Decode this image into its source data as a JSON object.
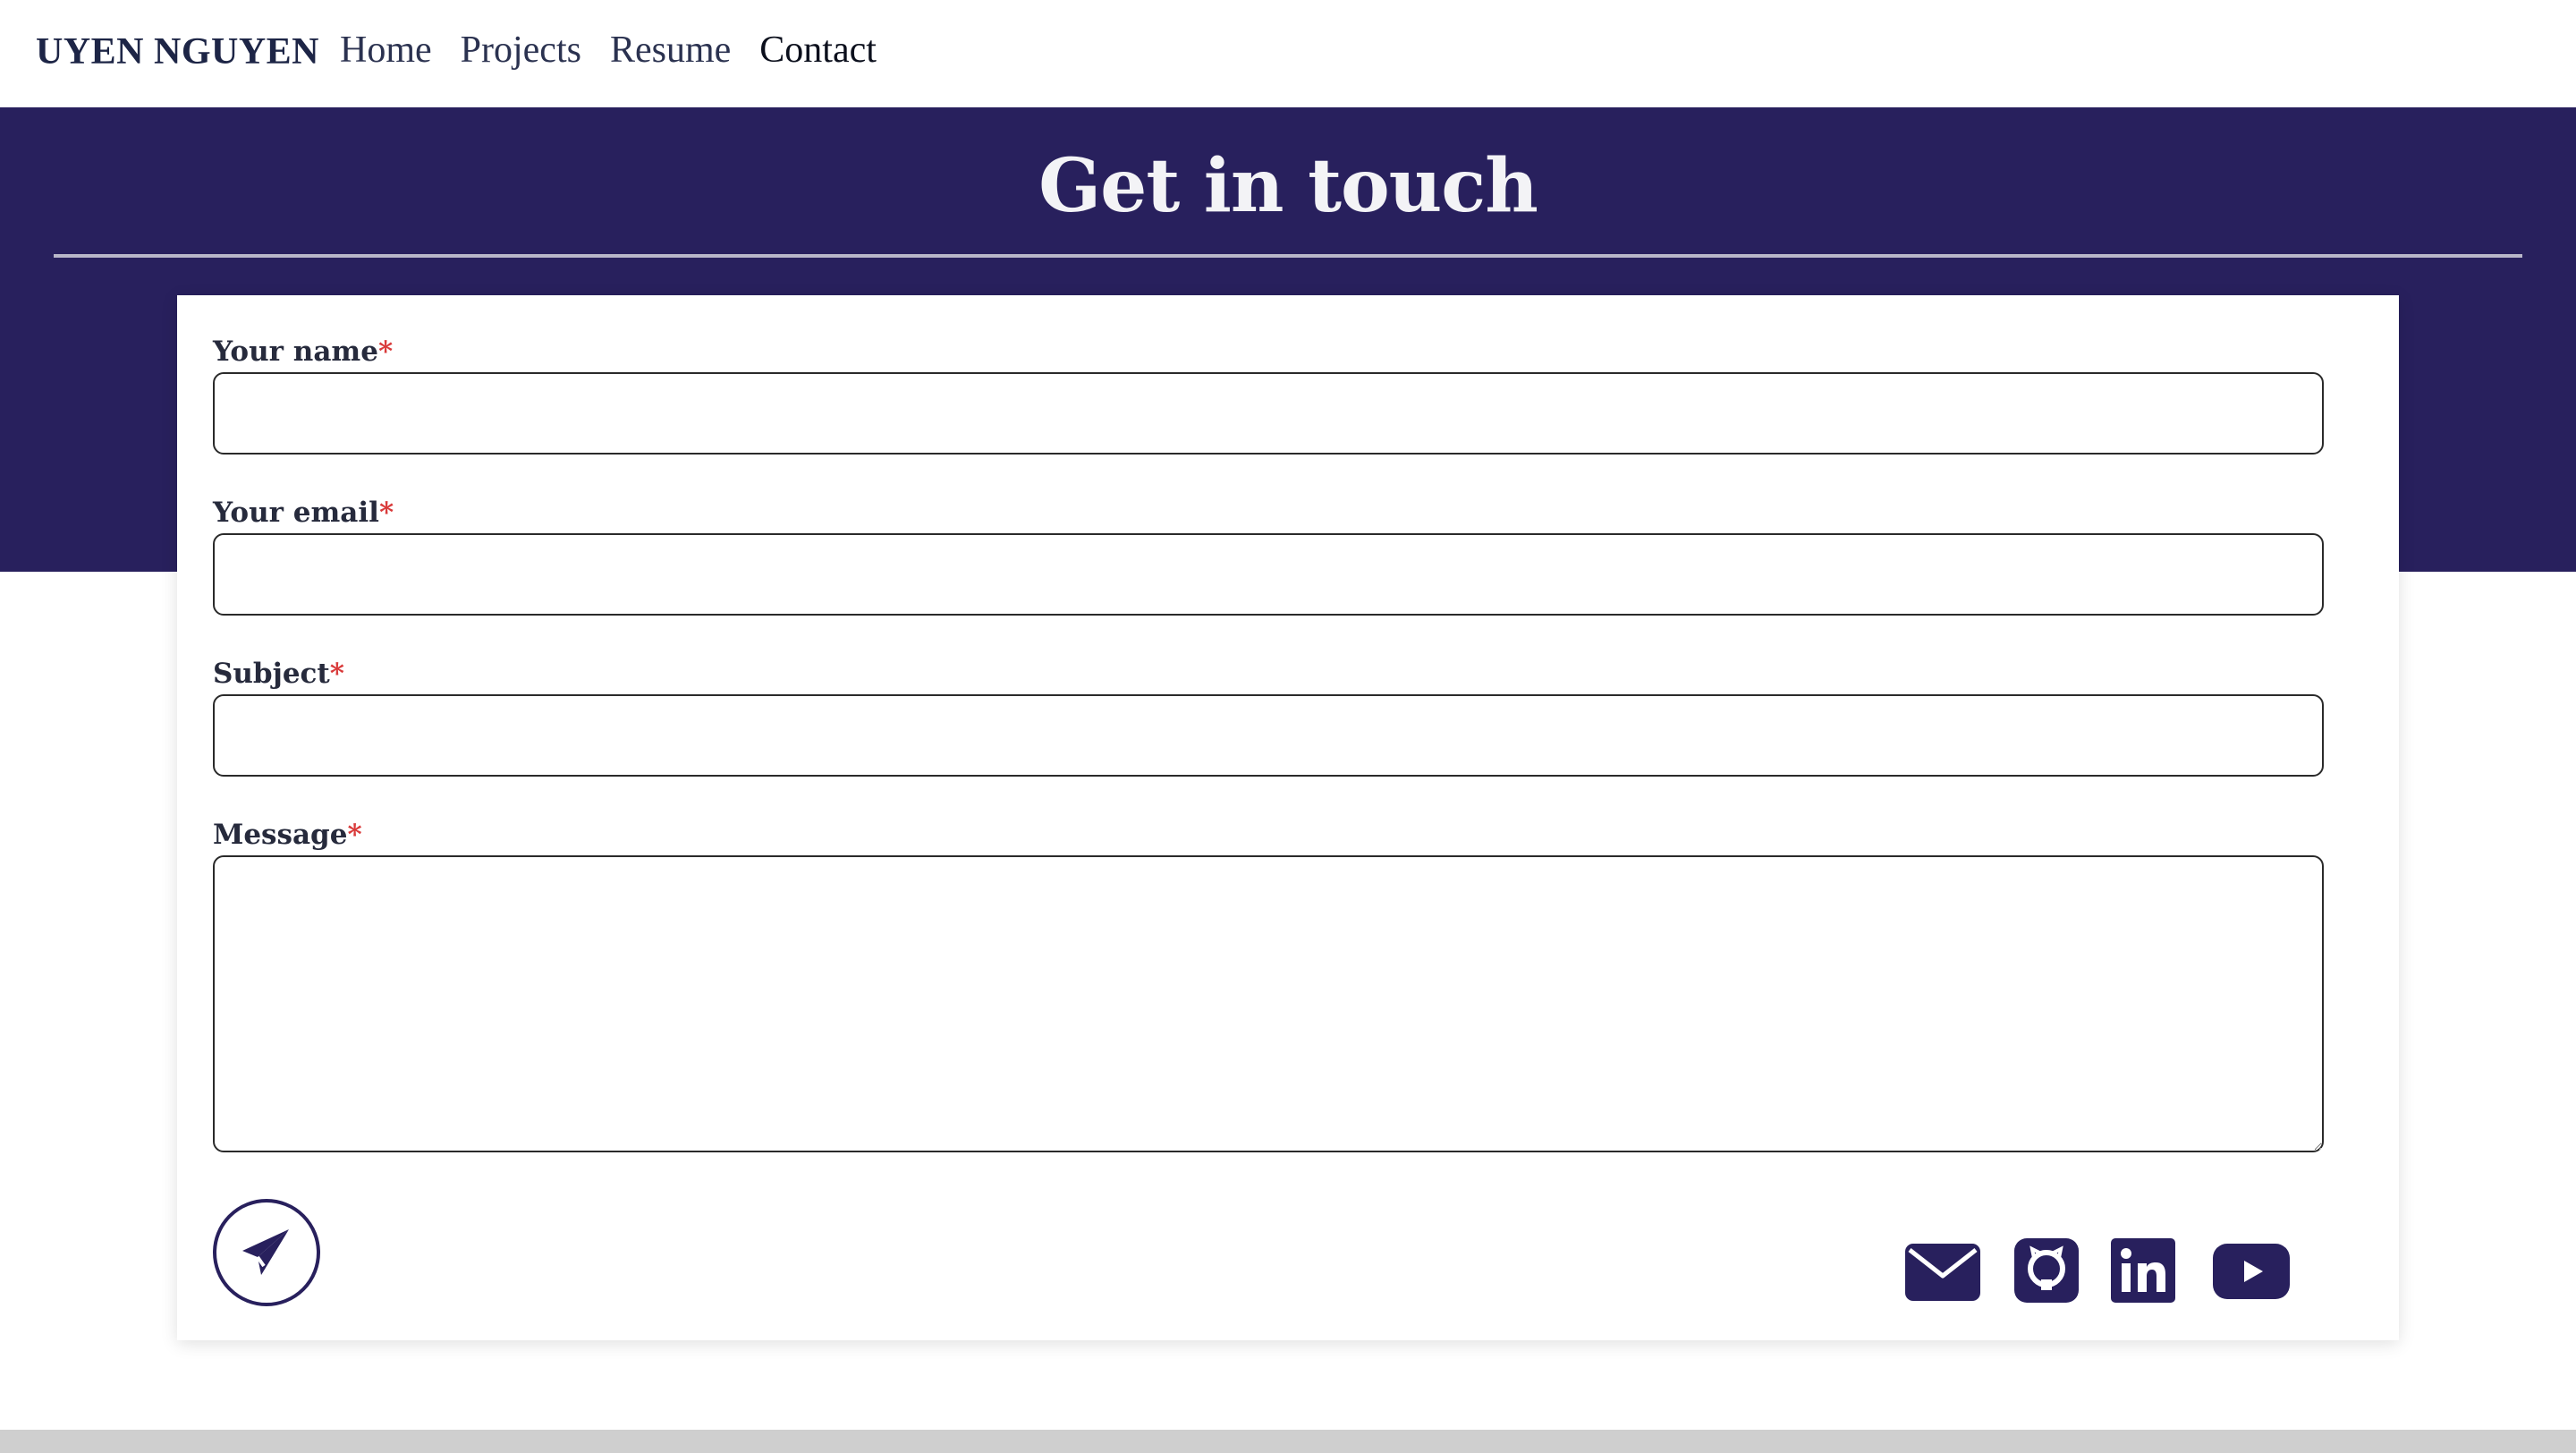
{
  "nav": {
    "brand": "UYEN NGUYEN",
    "links": [
      "Home",
      "Projects",
      "Resume",
      "Contact"
    ],
    "active": "Contact"
  },
  "hero": {
    "title": "Get in touch"
  },
  "form": {
    "fields": [
      {
        "label": "Your name",
        "required_mark": "*",
        "value": ""
      },
      {
        "label": "Your email",
        "required_mark": "*",
        "value": ""
      },
      {
        "label": "Subject",
        "required_mark": "*",
        "value": ""
      },
      {
        "label": "Message",
        "required_mark": "*",
        "value": ""
      }
    ],
    "send_icon": "paper-plane-icon"
  },
  "socials": [
    "envelope-icon",
    "github-icon",
    "linkedin-icon",
    "youtube-icon"
  ],
  "colors": {
    "brand_dark": "#28205d",
    "required": "#d93a3a",
    "nav_text": "#2b3250",
    "hero_text": "#f3f3f6"
  }
}
